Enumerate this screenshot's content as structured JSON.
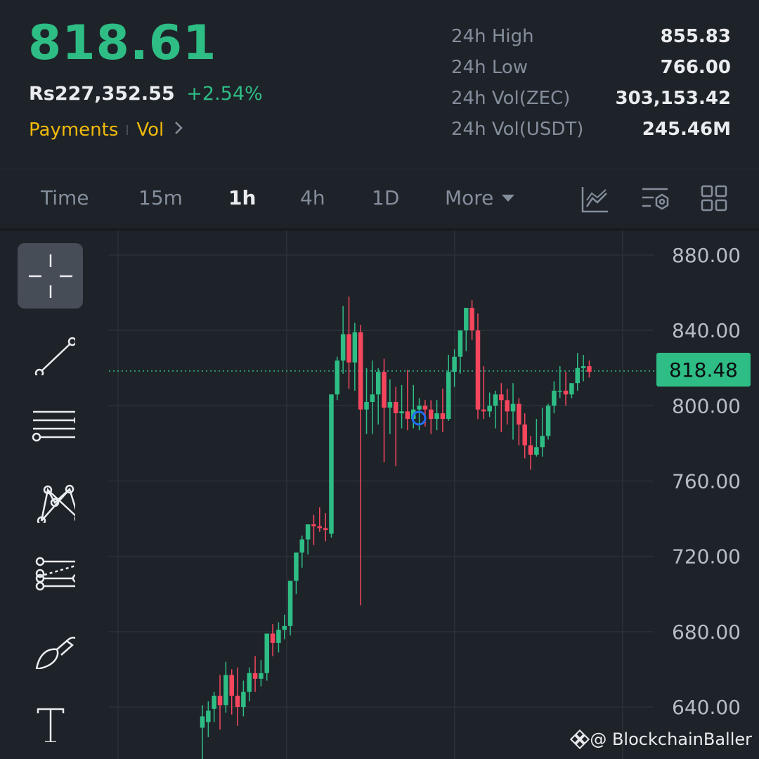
{
  "ticker": {
    "last_price": "818.61",
    "fiat_price": "Rs227,352.55",
    "change_pct": "+2.54%",
    "tags": [
      "Payments",
      "Vol"
    ]
  },
  "stats": [
    {
      "label": "24h High",
      "value": "855.83"
    },
    {
      "label": "24h Low",
      "value": "766.00"
    },
    {
      "label": "24h Vol(ZEC)",
      "value": "303,153.42"
    },
    {
      "label": "24h Vol(USDT)",
      "value": "245.46M"
    }
  ],
  "intervals": {
    "time": "Time",
    "m15": "15m",
    "h1": "1h",
    "h4": "4h",
    "d1": "1D",
    "more": "More",
    "active": "1h"
  },
  "toolbar_icons": [
    "line-chart-icon",
    "indicator-settings-icon",
    "grid-layout-icon"
  ],
  "drawing_tools": [
    "crosshair-icon",
    "trend-line-icon",
    "horizontal-lines-icon",
    "pattern-icon",
    "fib-tool-icon",
    "brush-icon",
    "text-tool-icon"
  ],
  "chart_data": {
    "type": "candlestick",
    "y_ticks": [
      "880.00",
      "840.00",
      "800.00",
      "760.00",
      "720.00",
      "680.00",
      "640.00"
    ],
    "ylim": [
      640,
      880
    ],
    "current_price": 818.48,
    "current_price_label": "818.48",
    "grid": true,
    "colors": {
      "up": "#2ebd85",
      "down": "#f6465d"
    },
    "candles": [
      [
        629,
        641,
        609,
        635
      ],
      [
        632,
        643,
        624,
        638
      ],
      [
        639,
        648,
        632,
        646
      ],
      [
        646,
        657,
        628,
        641
      ],
      [
        641,
        664,
        637,
        657
      ],
      [
        657,
        660,
        636,
        646
      ],
      [
        646,
        661,
        630,
        640
      ],
      [
        640,
        654,
        635,
        648
      ],
      [
        648,
        661,
        643,
        658
      ],
      [
        658,
        667,
        648,
        655
      ],
      [
        655,
        665,
        651,
        658
      ],
      [
        658,
        674,
        654,
        679
      ],
      [
        679,
        684,
        667,
        674
      ],
      [
        674,
        685,
        669,
        681
      ],
      [
        681,
        689,
        676,
        683
      ],
      [
        683,
        705,
        678,
        707
      ],
      [
        707,
        719,
        700,
        722
      ],
      [
        722,
        731,
        714,
        729
      ],
      [
        729,
        735,
        721,
        737
      ],
      [
        737,
        742,
        726,
        736
      ],
      [
        736,
        746,
        733,
        735
      ],
      [
        735,
        743,
        728,
        734
      ],
      [
        732,
        791,
        730,
        806
      ],
      [
        806,
        826,
        803,
        824
      ],
      [
        824,
        853,
        817,
        838
      ],
      [
        838,
        858,
        809,
        823
      ],
      [
        823,
        844,
        808,
        839
      ],
      [
        839,
        843,
        694,
        798
      ],
      [
        798,
        820,
        785,
        802
      ],
      [
        802,
        824,
        785,
        806
      ],
      [
        806,
        820,
        790,
        818
      ],
      [
        818,
        825,
        770,
        799
      ],
      [
        799,
        814,
        785,
        802
      ],
      [
        802,
        810,
        768,
        796
      ],
      [
        796,
        811,
        788,
        797
      ],
      [
        797,
        819,
        787,
        793
      ],
      [
        793,
        811,
        788,
        798
      ],
      [
        798,
        804,
        787,
        800
      ],
      [
        800,
        803,
        789,
        798
      ],
      [
        798,
        803,
        785,
        793
      ],
      [
        793,
        803,
        787,
        796
      ],
      [
        796,
        809,
        786,
        793
      ],
      [
        793,
        827,
        792,
        818
      ],
      [
        818,
        830,
        810,
        826
      ],
      [
        826,
        838,
        817,
        840
      ],
      [
        840,
        852,
        829,
        852
      ],
      [
        852,
        856,
        835,
        840
      ],
      [
        840,
        849,
        793,
        798
      ],
      [
        798,
        821,
        793,
        797
      ],
      [
        797,
        807,
        794,
        800
      ],
      [
        800,
        808,
        788,
        806
      ],
      [
        806,
        812,
        786,
        803
      ],
      [
        803,
        809,
        790,
        797
      ],
      [
        797,
        812,
        782,
        801
      ],
      [
        801,
        804,
        779,
        790
      ],
      [
        790,
        796,
        772,
        779
      ],
      [
        779,
        784,
        766,
        774
      ],
      [
        774,
        793,
        773,
        778
      ],
      [
        778,
        799,
        773,
        784
      ],
      [
        784,
        801,
        782,
        800
      ],
      [
        800,
        813,
        796,
        808
      ],
      [
        808,
        821,
        804,
        808
      ],
      [
        808,
        818,
        800,
        806
      ],
      [
        806,
        811,
        804,
        812
      ],
      [
        812,
        828,
        808,
        820
      ],
      [
        820,
        827,
        813,
        821
      ],
      [
        821,
        824,
        815,
        818
      ]
    ]
  },
  "watermark": "@ BlockchainBaller"
}
